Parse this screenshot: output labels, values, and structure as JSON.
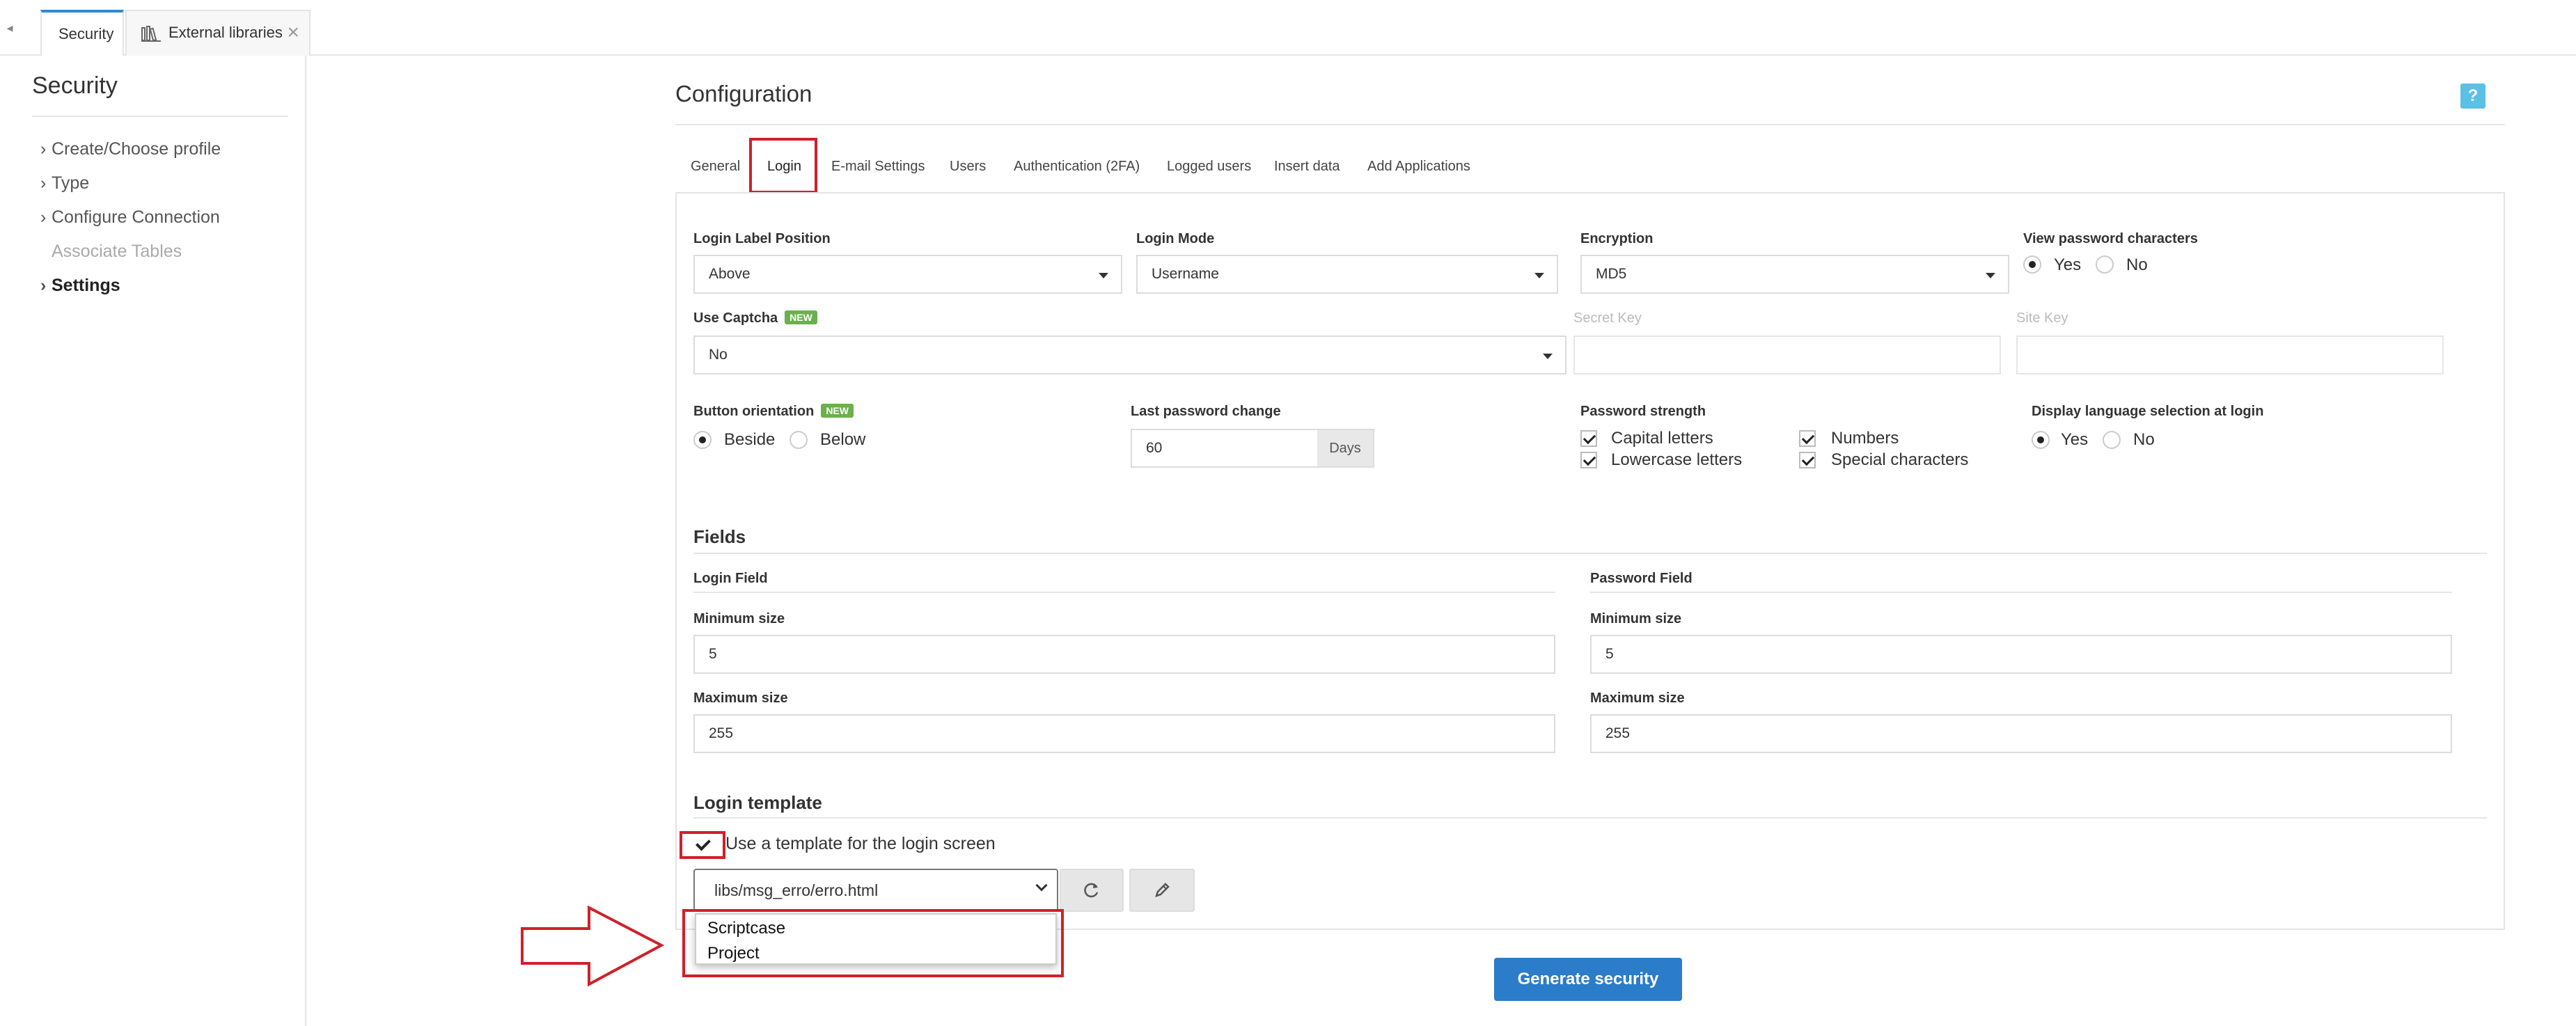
{
  "top_tabs": [
    {
      "label": "Security"
    },
    {
      "label": "External libraries"
    }
  ],
  "sidebar": {
    "title": "Security",
    "items": [
      {
        "label": "Create/Choose profile"
      },
      {
        "label": "Type"
      },
      {
        "label": "Configure Connection"
      },
      {
        "label": "Associate Tables"
      },
      {
        "label": "Settings"
      }
    ]
  },
  "main": {
    "title": "Configuration",
    "help": "?",
    "tabs": [
      {
        "label": "General"
      },
      {
        "label": "Login"
      },
      {
        "label": "E-mail Settings"
      },
      {
        "label": "Users"
      },
      {
        "label": "Authentication (2FA)"
      },
      {
        "label": "Logged users"
      },
      {
        "label": "Insert data"
      },
      {
        "label": "Add Applications"
      }
    ]
  },
  "login": {
    "label_position": {
      "label": "Login Label Position",
      "value": "Above"
    },
    "mode": {
      "label": "Login Mode",
      "value": "Username"
    },
    "encryption": {
      "label": "Encryption",
      "value": "MD5"
    },
    "view_password": {
      "label": "View password characters",
      "yes": "Yes",
      "no": "No"
    },
    "captcha": {
      "label": "Use Captcha",
      "badge": "NEW",
      "value": "No"
    },
    "secret_key": {
      "label": "Secret Key"
    },
    "site_key": {
      "label": "Site Key"
    },
    "button_orientation": {
      "label": "Button orientation",
      "badge": "NEW",
      "beside": "Beside",
      "below": "Below"
    },
    "last_password_change": {
      "label": "Last password change",
      "value": "60",
      "unit": "Days"
    },
    "password_strength": {
      "label": "Password strength",
      "capital": "Capital letters",
      "numbers": "Numbers",
      "lowercase": "Lowercase letters",
      "special": "Special characters"
    },
    "language_selection": {
      "label": "Display language selection at login",
      "yes": "Yes",
      "no": "No"
    }
  },
  "fields": {
    "title": "Fields",
    "login_field": {
      "title": "Login Field",
      "min_label": "Minimum size",
      "min_value": "5",
      "max_label": "Maximum size",
      "max_value": "255"
    },
    "password_field": {
      "title": "Password Field",
      "min_label": "Minimum size",
      "min_value": "5",
      "max_label": "Maximum size",
      "max_value": "255"
    }
  },
  "template": {
    "title": "Login template",
    "use_label": "Use a template for the login screen",
    "selected": "libs/msg_erro/erro.html",
    "options": [
      "Scriptcase",
      "Project"
    ]
  },
  "generate_button": "Generate security",
  "colors": {
    "accent": "#2b8bd0",
    "highlight": "#d0202a",
    "badge": "#6ab04c",
    "primary_button": "#2b7cc9"
  }
}
